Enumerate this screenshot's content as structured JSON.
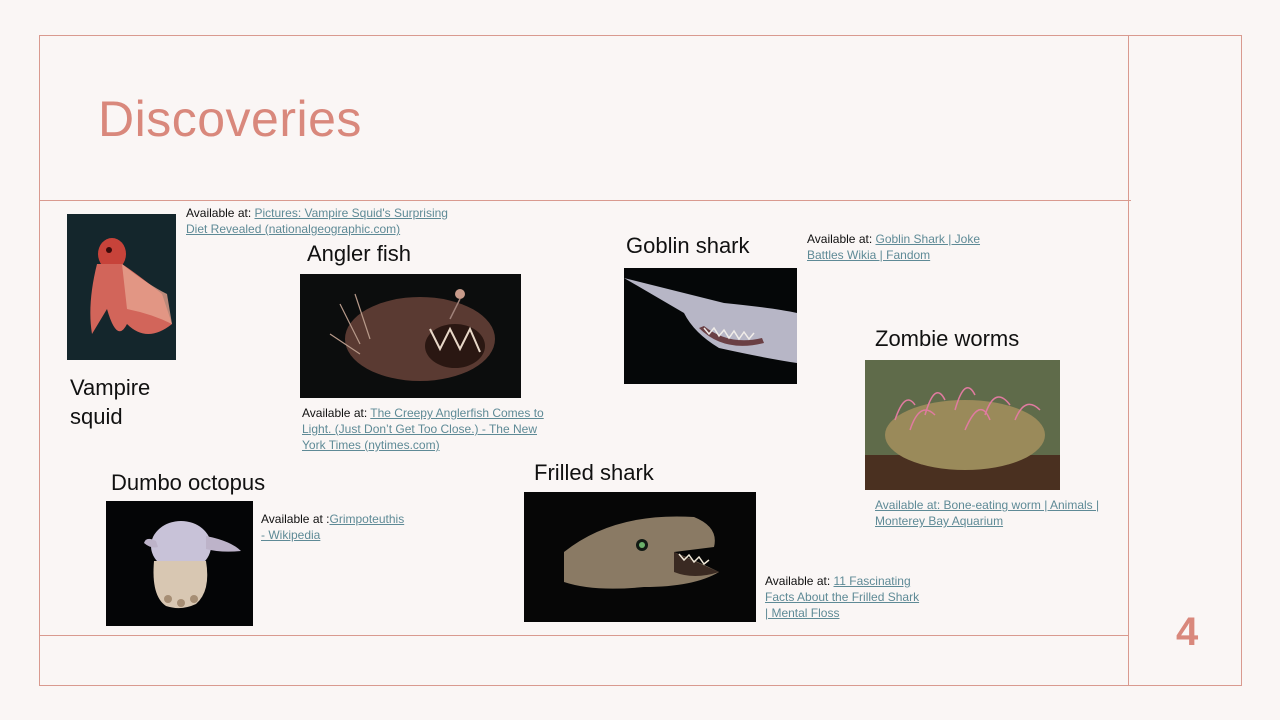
{
  "slide": {
    "title": "Discoveries",
    "page_number": "4",
    "accent_color": "#d9887c",
    "link_color": "#5e8a96"
  },
  "creatures": {
    "vampire_squid": {
      "label": "Vampire squid",
      "caption_prefix": "Available at: ",
      "link_text": "Pictures: Vampire Squid's Surprising Diet Revealed (nationalgeographic.com)"
    },
    "angler_fish": {
      "label": "Angler fish",
      "caption_prefix": "Available at: ",
      "link_text": "The Creepy Anglerfish Comes to Light. (Just Don’t Get Too Close.) - The New York Times (nytimes.com)"
    },
    "goblin_shark": {
      "label": "Goblin shark",
      "caption_prefix": "Available at: ",
      "link_text": "Goblin Shark | Joke Battles Wikia | Fandom"
    },
    "zombie_worms": {
      "label": "Zombie worms",
      "caption_prefix": "",
      "link_text": "Available at: Bone-eating worm | Animals | Monterey Bay Aquarium"
    },
    "dumbo_octopus": {
      "label": "Dumbo octopus",
      "caption_prefix": "Available at :",
      "link_text": "Grimpoteuthis - Wikipedia"
    },
    "frilled_shark": {
      "label": "Frilled shark",
      "caption_prefix": "Available at: ",
      "link_text": "11 Fascinating Facts About the Frilled Shark | Mental Floss"
    }
  }
}
